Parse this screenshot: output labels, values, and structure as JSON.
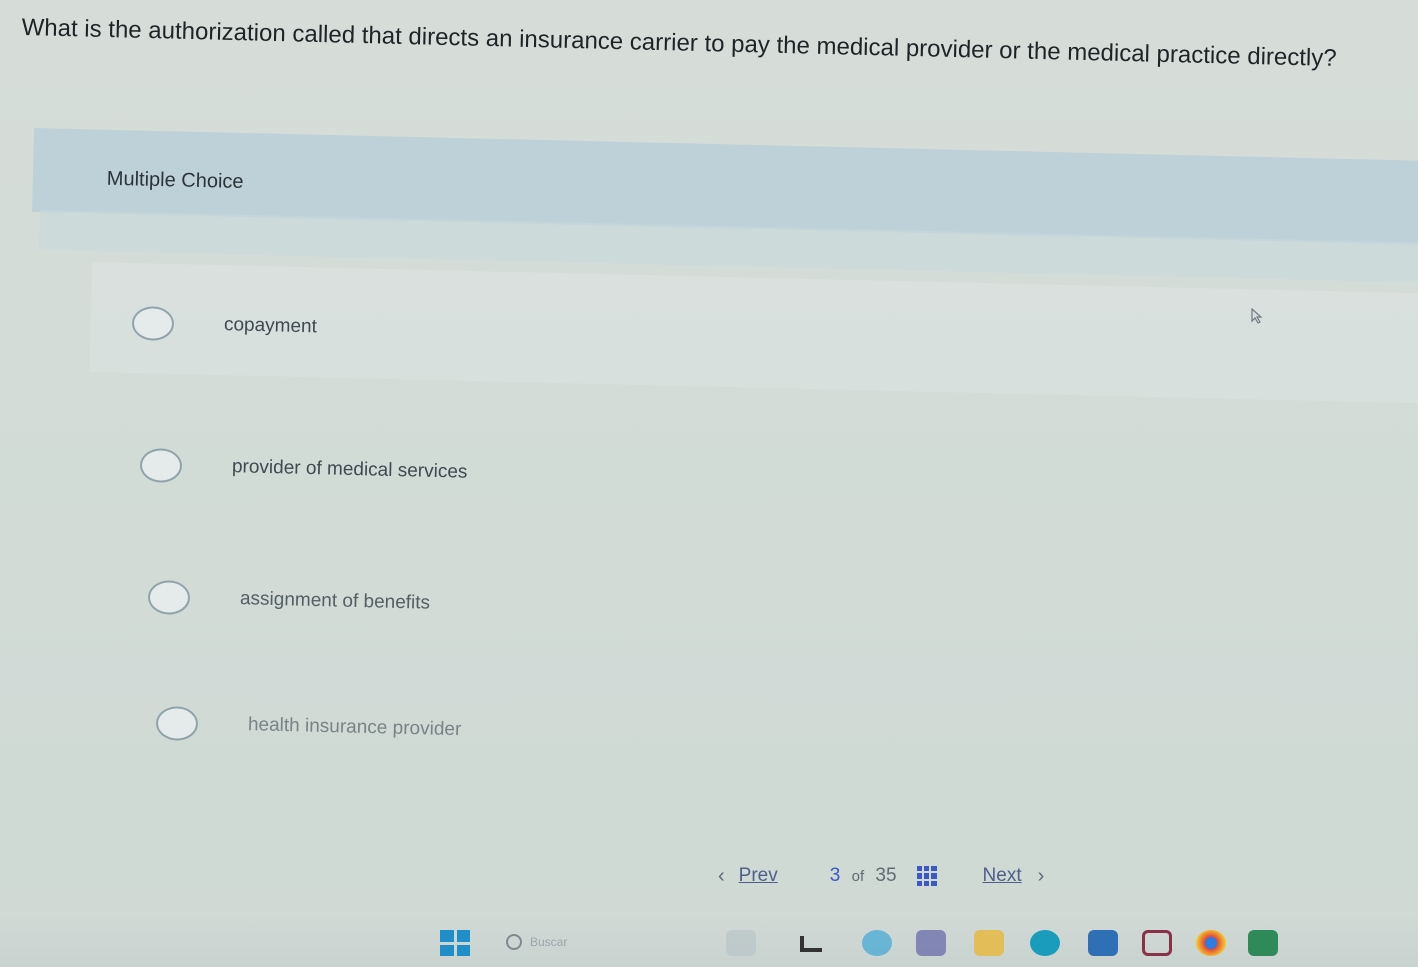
{
  "question": {
    "text": "What is the authorization called that directs an insurance carrier to pay the medical provider or the medical practice directly?"
  },
  "question_type": "Multiple Choice",
  "options": [
    {
      "label": "copayment"
    },
    {
      "label": "provider of medical services"
    },
    {
      "label": "assignment of benefits"
    },
    {
      "label": "health insurance provider"
    }
  ],
  "navigation": {
    "prev_label": "Prev",
    "current": "3",
    "of_label": "of",
    "total": "35",
    "next_label": "Next"
  },
  "taskbar": {
    "search_placeholder": "Buscar"
  },
  "colors": {
    "accent": "#3c58c8",
    "banner": "#bfd1d8",
    "background": "#d3dcd8"
  }
}
